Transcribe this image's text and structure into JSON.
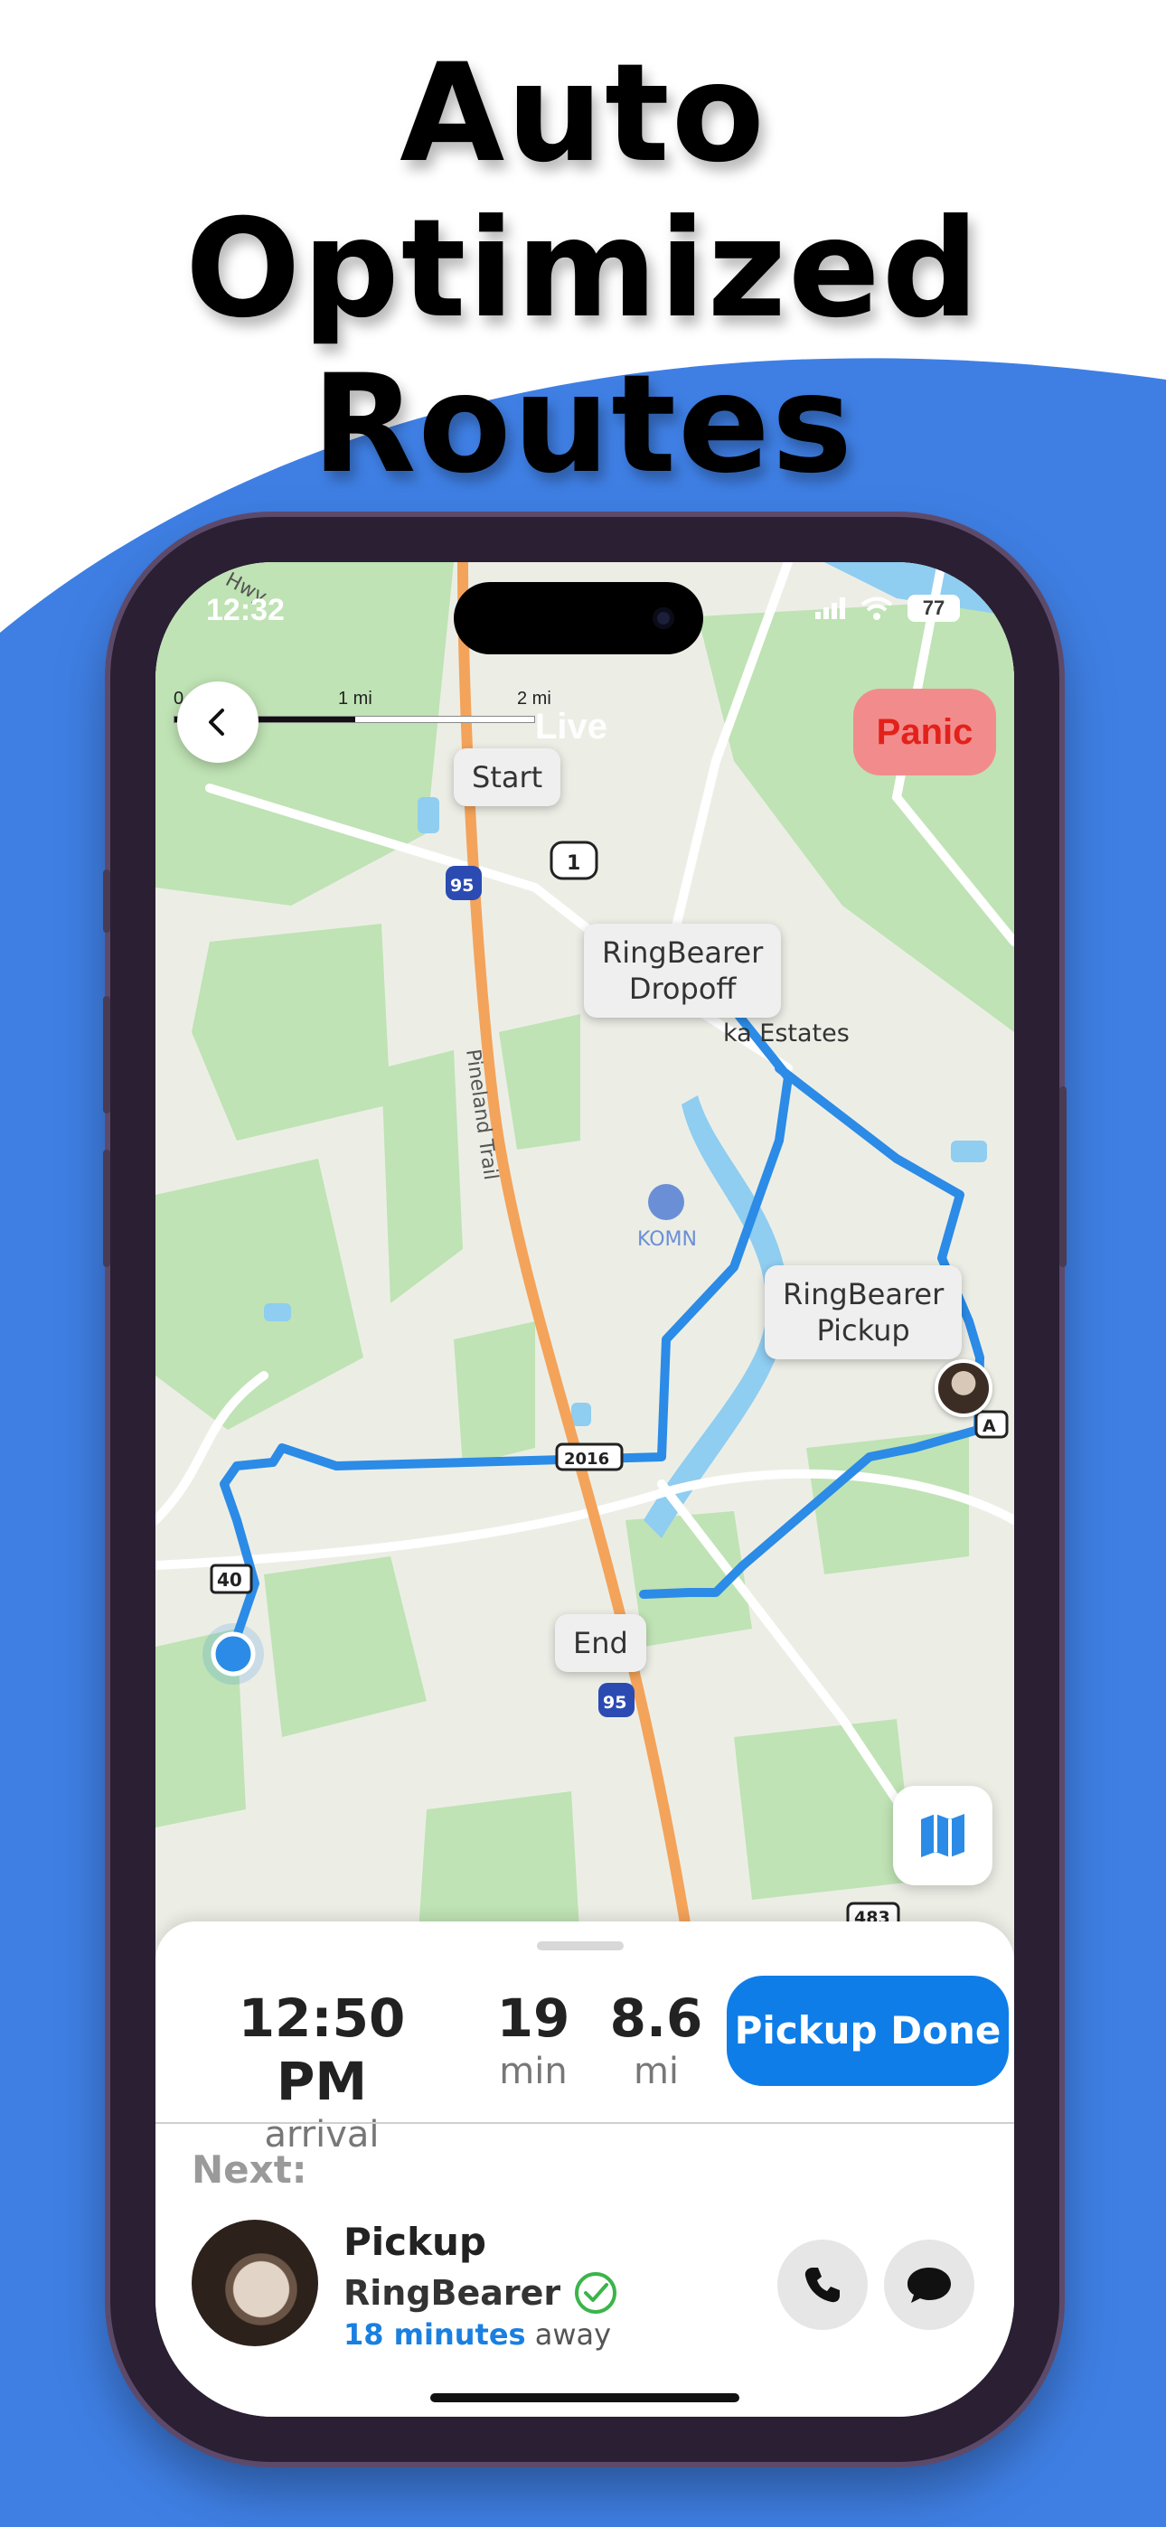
{
  "headline": {
    "line1": "Auto Optimized",
    "line2": "Routes"
  },
  "colors": {
    "background_wave": "#3f7fe4",
    "accent": "#0e7de8",
    "panic": "#f28c8c",
    "route": "#2b8be6"
  },
  "status_bar": {
    "time": "12:32",
    "battery": "77"
  },
  "map": {
    "scale_labels": [
      "0",
      "1 mi",
      "2 mi"
    ],
    "live_label": "Live",
    "panic_label": "Panic",
    "labels": {
      "start": "Start",
      "dropoff": "RingBearer\nDropoff",
      "pickup": "RingBearer\nPickup",
      "end": "End",
      "estates": "ka Estates",
      "airport": "KOMN",
      "road": "Pineland Trail",
      "hwy": "Hwy",
      "shield_95": "95",
      "shield_1": "1",
      "shield_40": "40",
      "shield_483": "483",
      "shield_2016": "2016",
      "shield_a": "A"
    }
  },
  "trip": {
    "arrival_value": "12:50 PM",
    "arrival_unit": "arrival",
    "minutes_value": "19",
    "minutes_unit": "min",
    "miles_value": "8.6",
    "miles_unit": "mi",
    "action_label": "Pickup Done"
  },
  "next": {
    "heading": "Next:",
    "type": "Pickup",
    "name": "RingBearer",
    "eta_minutes": "18 minutes",
    "eta_suffix": "away"
  }
}
